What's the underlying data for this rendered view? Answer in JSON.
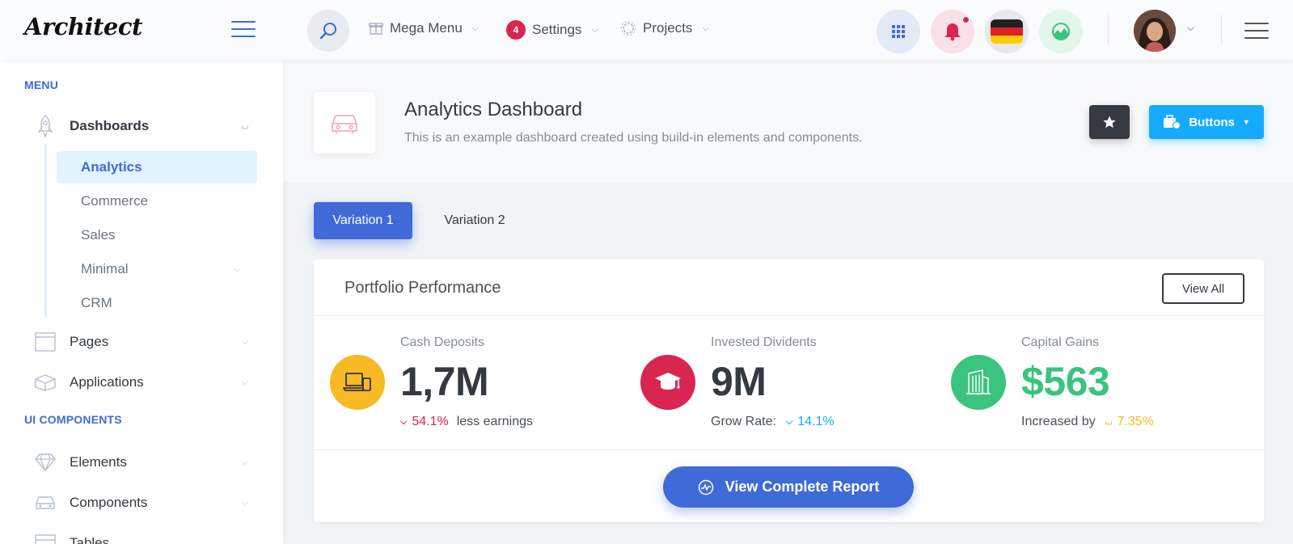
{
  "header": {
    "logo_text": "Architect",
    "nav": [
      {
        "label": "Mega Menu",
        "icon": "gift-icon"
      },
      {
        "label": "Settings",
        "badge": "4"
      },
      {
        "label": "Projects",
        "icon": "cog-icon"
      }
    ],
    "icon_buttons": [
      "grid-icon",
      "bell-icon",
      "german-flag-icon",
      "chart-icon"
    ],
    "colors": {
      "accent": "#3f6ad8",
      "danger": "#d92550"
    }
  },
  "sidebar": {
    "menu_heading": "MENU",
    "dashboards_label": "Dashboards",
    "sub_items": [
      "Analytics",
      "Commerce",
      "Sales",
      "Minimal",
      "CRM"
    ],
    "pages_label": "Pages",
    "applications_label": "Applications",
    "ui_heading": "UI COMPONENTS",
    "elements_label": "Elements",
    "components_label": "Components",
    "tables_label": "Tables"
  },
  "page": {
    "title": "Analytics Dashboard",
    "subtitle": "This is an example dashboard created using build-in elements and components.",
    "buttons_label": "Buttons"
  },
  "tabs": {
    "active": "Variation 1",
    "other": "Variation 2"
  },
  "card": {
    "title": "Portfolio Performance",
    "view_all": "View All",
    "widgets": [
      {
        "label": "Cash Deposits",
        "value": "1,7M",
        "change": "54.1%",
        "suffix": "less earnings",
        "icon_color": "#f7b924",
        "value_color": "#343a40",
        "change_color": "#d92550"
      },
      {
        "label": "Invested Dividents",
        "value": "9M",
        "prefix": "Grow Rate:",
        "change": "14.1%",
        "icon_color": "#d92550",
        "value_color": "#343a40",
        "change_color": "#16aaff"
      },
      {
        "label": "Capital Gains",
        "value": "$563",
        "prefix": "Increased by",
        "change": "7.35%",
        "icon_color": "#3ac47d",
        "value_color": "#3ac47d",
        "change_color": "#f7b924"
      }
    ],
    "report_button": "View Complete Report"
  }
}
